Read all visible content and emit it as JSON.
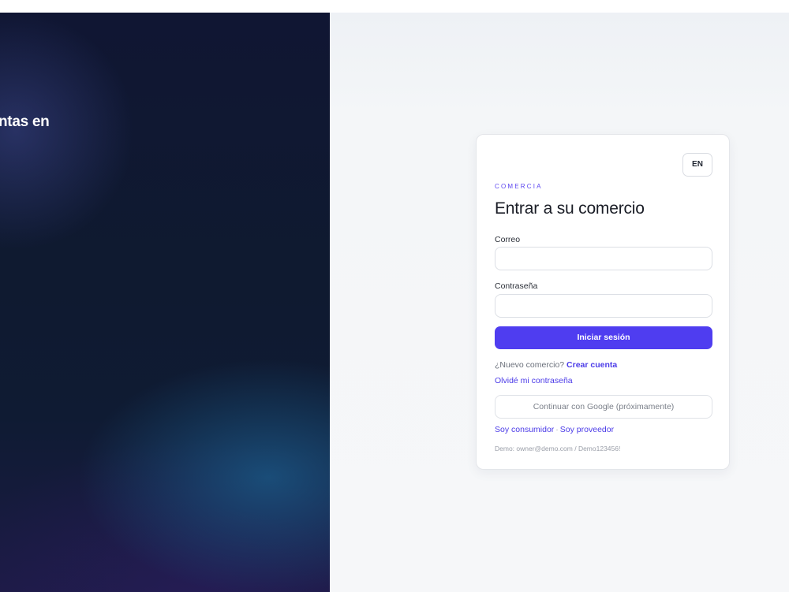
{
  "hero": {
    "heading": "ntas en"
  },
  "language_toggle": {
    "label": "EN"
  },
  "brand": "COMERCIA",
  "title": "Entrar a su comercio",
  "form": {
    "email_label": "Correo",
    "email_value": "",
    "password_label": "Contraseña",
    "password_value": "",
    "submit_label": "Iniciar sesión"
  },
  "signup": {
    "prompt": "¿Nuevo comercio?",
    "link": "Crear cuenta"
  },
  "forgot_password": "Olvidé mi contraseña",
  "google_button": "Continuar con Google (próximamente)",
  "role_links": {
    "consumer": "Soy consumidor",
    "separator": "·",
    "provider": "Soy proveedor"
  },
  "demo_credentials": "Demo: owner@demo.com / Demo123456!",
  "colors": {
    "accent": "#4f3df0",
    "hero_background": "#101633",
    "panel_background": "#f4f6f8"
  }
}
